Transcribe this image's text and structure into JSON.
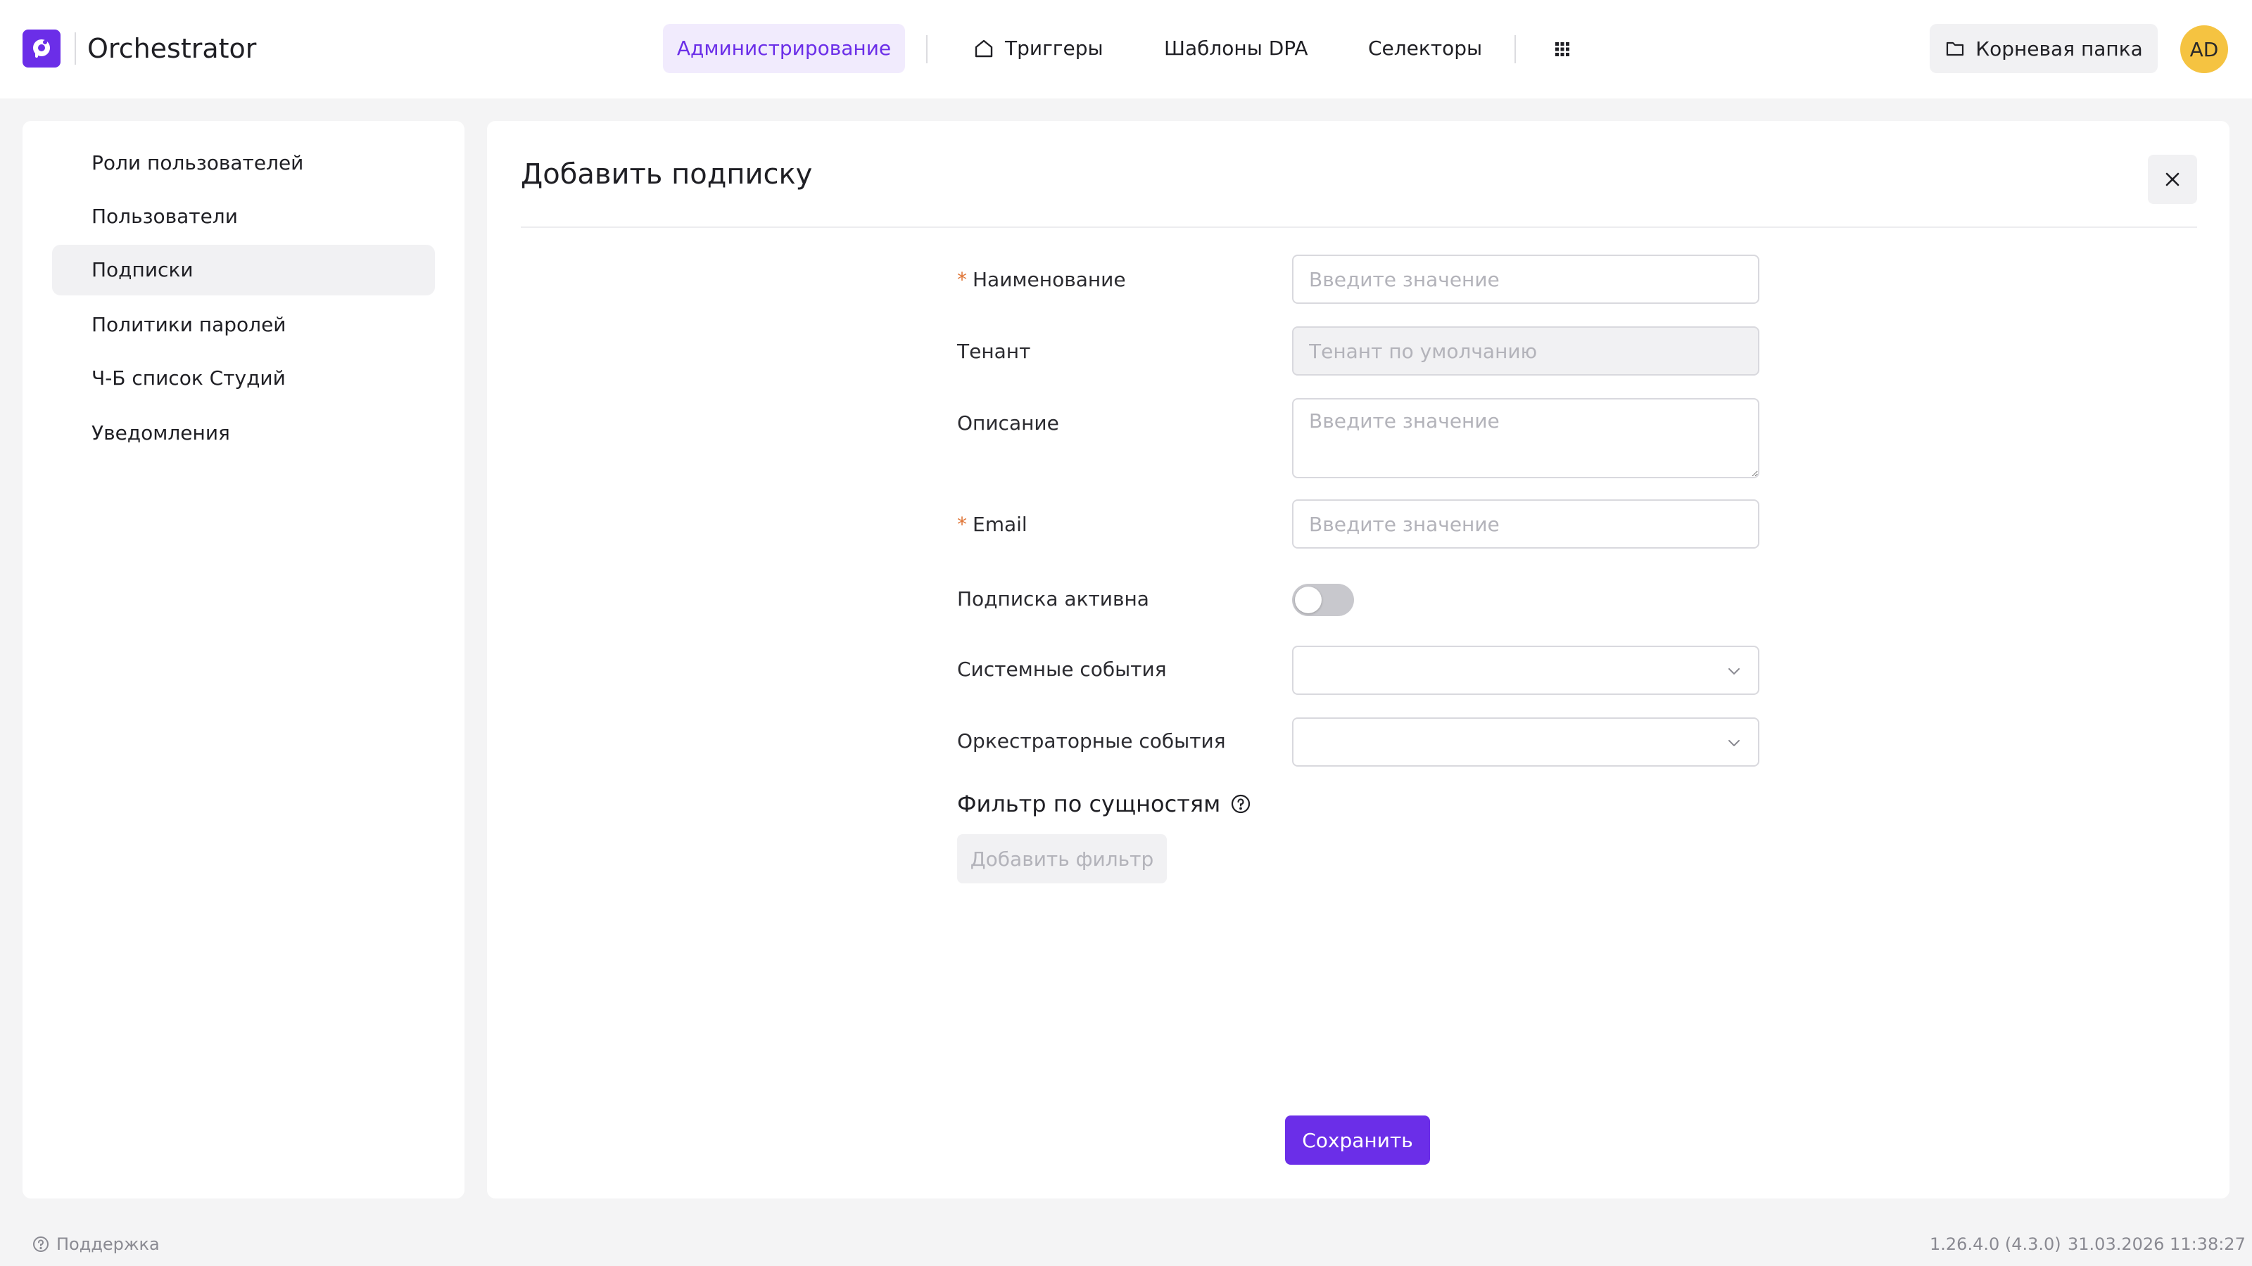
{
  "app": {
    "title": "Orchestrator",
    "accent_color": "#6b2ee8"
  },
  "nav": {
    "admin_label": "Администрирование",
    "triggers_label": "Триггеры",
    "triggers_icon": "home-icon",
    "templates_label": "Шаблоны DPA",
    "selectors_label": "Селекторы",
    "apps_icon": "grid-icon"
  },
  "header_right": {
    "root_folder_label": "Корневая папка",
    "root_folder_icon": "folder-icon",
    "avatar_initials": "AD",
    "avatar_color": "#f5c341"
  },
  "sidebar": {
    "items": [
      {
        "label": "Роли пользователей",
        "active": false
      },
      {
        "label": "Пользователи",
        "active": false
      },
      {
        "label": "Подписки",
        "active": true
      },
      {
        "label": "Политики паролей",
        "active": false
      },
      {
        "label": "Ч-Б список Студий",
        "active": false
      },
      {
        "label": "Уведомления",
        "active": false
      }
    ]
  },
  "form": {
    "title": "Добавить подписку",
    "required_mark": "*",
    "fields": {
      "name": {
        "label": "Наименование",
        "required": true,
        "placeholder": "Введите значение",
        "value": ""
      },
      "tenant": {
        "label": "Тенант",
        "required": false,
        "placeholder": "Тенант по умолчанию",
        "disabled": true
      },
      "description": {
        "label": "Описание",
        "required": false,
        "placeholder": "Введите значение",
        "value": ""
      },
      "email": {
        "label": "Email",
        "required": true,
        "placeholder": "Введите значение",
        "value": ""
      },
      "active": {
        "label": "Подписка активна",
        "checked": false
      },
      "system_events": {
        "label": "Системные события",
        "value": ""
      },
      "orchestrator_events": {
        "label": "Оркестраторные события",
        "value": ""
      }
    },
    "filter_section_title": "Фильтр по сущностям",
    "add_filter_label": "Добавить фильтр",
    "save_label": "Сохранить"
  },
  "footer": {
    "support_label": "Поддержка",
    "version": "1.26.4.0 (4.3.0)",
    "datetime": "31.03.2026 11:38:27"
  }
}
